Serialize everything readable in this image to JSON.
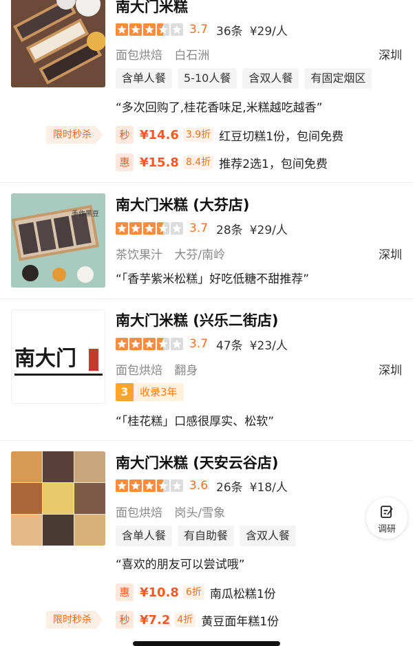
{
  "shops": [
    {
      "name": "南大门米糕",
      "rating_value": 3.5,
      "score": "3.7",
      "reviews": "36条",
      "price": "¥29/人",
      "category": "面包烘焙",
      "area": "白石洲",
      "city": "深圳",
      "tags": [
        "含单人餐",
        "5-10人餐",
        "含双人餐",
        "有固定烟区"
      ],
      "quote": "“多次回购了,桂花香味足,米糕越吃越香”",
      "deals": [
        {
          "flash_label": "限时秒杀",
          "badge": "秒",
          "price": "¥14.6",
          "discount": "3.9折",
          "text": "红豆切糕1份，包间免费"
        },
        {
          "flash_label": "",
          "badge": "惠",
          "price": "¥15.8",
          "discount": "8.4折",
          "text": "推荐2选1，包间免费"
        }
      ]
    },
    {
      "name": "南大门米糕 (大芬店)",
      "rating_value": 3.5,
      "score": "3.7",
      "reviews": "28条",
      "price": "¥29/人",
      "category": "茶饮果汁",
      "area": "大芬/南岭",
      "city": "深圳",
      "quote": "“「香芋紫米松糕」好吃低糖不甜推荐”",
      "thumb_text": "手作黑豆"
    },
    {
      "name": "南大门米糕 (兴乐二街店)",
      "rating_value": 3.5,
      "score": "3.7",
      "reviews": "47条",
      "price": "¥23/人",
      "category": "面包烘焙",
      "area": "翻身",
      "city": "深圳",
      "years_num": "3",
      "years_text": "收录3年",
      "quote": "“「桂花糕」口感很厚实、松软”",
      "logo_text": "南大门"
    },
    {
      "name": "南大门米糕 (天安云谷店)",
      "rating_value": 3.5,
      "score": "3.6",
      "reviews": "26条",
      "price": "¥18/人",
      "category": "面包烘焙",
      "area": "岗头/雪象",
      "city": "",
      "tags": [
        "含单人餐",
        "有自助餐",
        "含双人餐"
      ],
      "quote": "“喜欢的朋友可以尝试哦”",
      "deals": [
        {
          "flash_label": "",
          "badge": "惠",
          "price": "¥10.8",
          "discount": "6折",
          "text": "南瓜松糕1份"
        },
        {
          "flash_label": "限时秒杀",
          "badge": "秒",
          "price": "¥7.2",
          "discount": "4折",
          "text": "黄豆面年糕1份"
        }
      ]
    }
  ],
  "fab": {
    "label": "调研",
    "icon": "edit-note-icon"
  },
  "colors": {
    "accent": "#ff6f1e",
    "star": "#ff8b3d",
    "deal": "#ff5722"
  }
}
